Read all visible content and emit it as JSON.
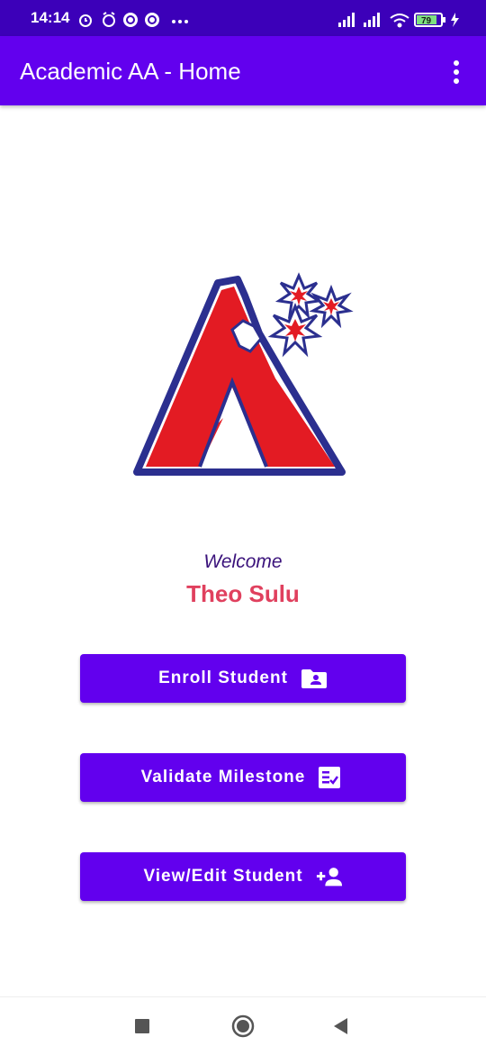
{
  "status_bar": {
    "time": "14:14",
    "battery": "79",
    "icons": [
      "alarm-icon",
      "alarm-clock-icon",
      "vpn-icon",
      "vpn-icon",
      "more-dots-icon",
      "signal-icon",
      "signal-icon",
      "wifi-icon",
      "battery-icon",
      "charging-icon"
    ]
  },
  "app_bar": {
    "title": "Academic AA - Home",
    "menu_icon": "more-vert-icon"
  },
  "logo": {
    "icon": "letter-a-logo"
  },
  "welcome": {
    "label": "Welcome",
    "name": "Theo Sulu"
  },
  "buttons": [
    {
      "label": "Enroll Student",
      "icon": "contact-folder-icon"
    },
    {
      "label": "Validate Milestone",
      "icon": "checklist-icon"
    },
    {
      "label": "View/Edit Student",
      "icon": "person-add-icon"
    }
  ],
  "colors": {
    "primary": "#6200ee",
    "status_bar": "#3c00b9",
    "welcome_text": "#3a127b",
    "name_text": "#e0405e"
  },
  "nav_bar": {
    "icons": [
      "recents-square-icon",
      "home-circle-icon",
      "back-triangle-icon"
    ]
  }
}
